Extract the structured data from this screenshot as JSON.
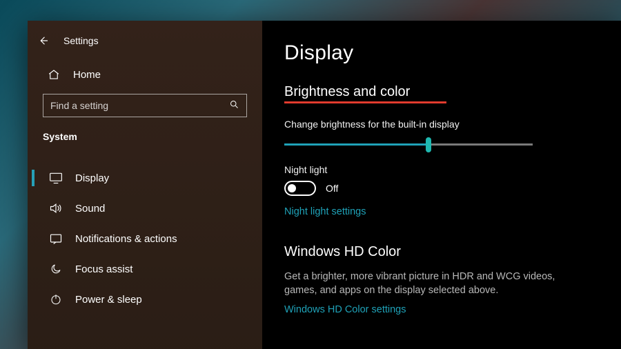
{
  "app_title": "Settings",
  "home_label": "Home",
  "search": {
    "placeholder": "Find a setting"
  },
  "section_label": "System",
  "nav": [
    {
      "label": "Display",
      "active": true
    },
    {
      "label": "Sound"
    },
    {
      "label": "Notifications & actions"
    },
    {
      "label": "Focus assist"
    },
    {
      "label": "Power & sleep"
    }
  ],
  "page_title": "Display",
  "brightness_heading": "Brightness and color",
  "brightness_label": "Change brightness for the built-in display",
  "brightness_percent": 58,
  "night_light_label": "Night light",
  "night_light_state": "Off",
  "night_light_link": "Night light settings",
  "hd_heading": "Windows HD Color",
  "hd_desc": "Get a brighter, more vibrant picture in HDR and WCG videos, games, and apps on the display selected above.",
  "hd_link": "Windows HD Color settings",
  "colors": {
    "accent": "#1fa2b8",
    "underline": "#e23b2e"
  }
}
